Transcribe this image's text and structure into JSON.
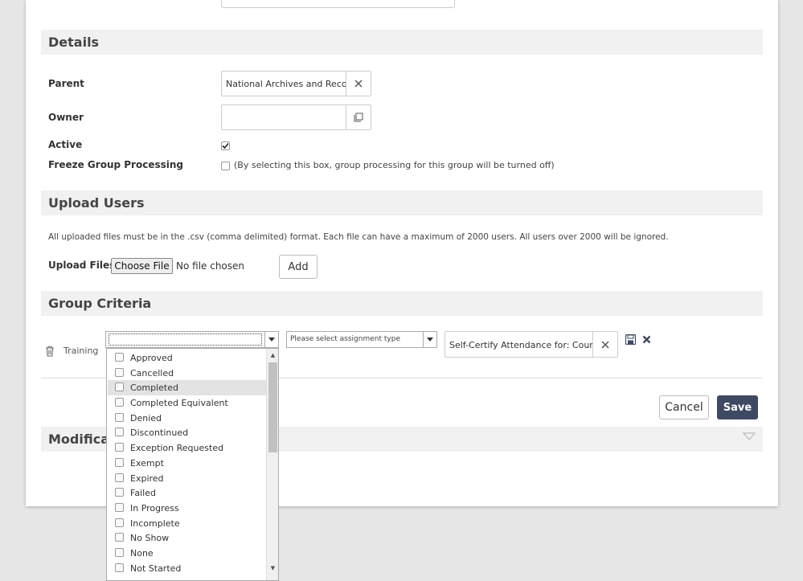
{
  "details": {
    "title": "Details",
    "parent_label": "Parent",
    "parent_value": "National Archives and Records",
    "owner_label": "Owner",
    "owner_value": "",
    "active_label": "Active",
    "active_checked": true,
    "freeze_label": "Freeze Group Processing",
    "freeze_hint": "(By selecting this box, group processing for this group will be turned off)"
  },
  "upload": {
    "title": "Upload Users",
    "note": "All uploaded files must be in the .csv (comma delimited) format. Each file can have a maximum of 2000 users. All users over 2000 will be ignored.",
    "files_label": "Upload Files:",
    "choose_label": "Choose File",
    "no_file": "No file chosen",
    "add_label": "Add"
  },
  "criteria": {
    "title": "Group Criteria",
    "row_label": "Training",
    "status_value": "",
    "assignment_placeholder": "Please select assignment type",
    "course_value": "Self-Certify Attendance for: Course",
    "status_options": [
      "Approved",
      "Cancelled",
      "Completed",
      "Completed Equivalent",
      "Denied",
      "Discontinued",
      "Exception Requested",
      "Exempt",
      "Expired",
      "Failed",
      "In Progress",
      "Incomplete",
      "No Show",
      "None",
      "Not Started"
    ],
    "highlighted_option": "Completed"
  },
  "actions": {
    "cancel_label": "Cancel",
    "save_label": "Save"
  },
  "modifications": {
    "title": "Modificati"
  },
  "colors": {
    "save_bg": "#3e4a62",
    "section_bg": "#f1f1f1",
    "page_bg": "#e6e6e6"
  }
}
